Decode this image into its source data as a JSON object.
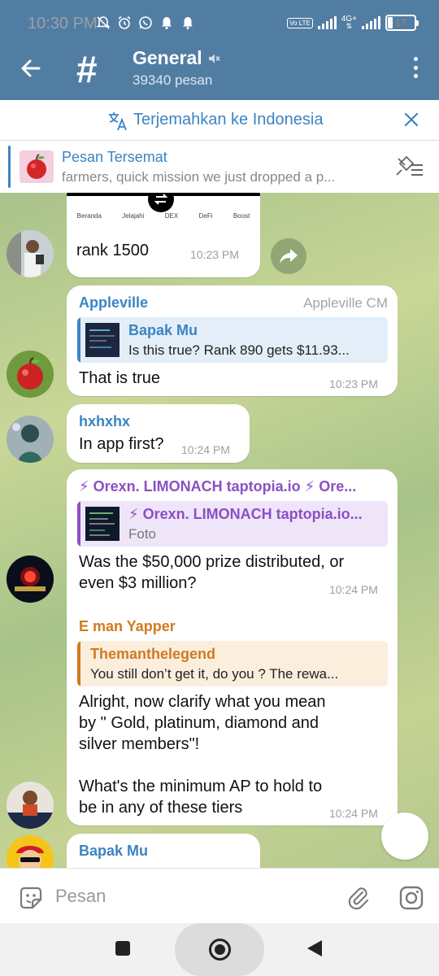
{
  "status_bar": {
    "time": "10:30 PM",
    "network": "4G+",
    "volte": "Vo LTE",
    "battery": "17"
  },
  "header": {
    "title": "General",
    "subtitle": "39340 pesan"
  },
  "translate_bar": {
    "label": "Terjemahkan ke Indonesia"
  },
  "pinned": {
    "title": "Pesan Tersemat",
    "text": "farmers, quick mission   we just dropped a p..."
  },
  "messages": [
    {
      "type": "screenshot-partial",
      "tabs": [
        "Beranda",
        "Jelajahi",
        "DEX",
        "DeFi",
        "Boost"
      ],
      "text": "rank 1500",
      "time": "10:23 PM"
    },
    {
      "sender": "Appleville",
      "sender_color": "#3b84c2",
      "role": "Appleville CM",
      "quote_name": "Bapak Mu",
      "quote_text": "Is this true? Rank 890 gets $11.93...",
      "text": "That is true",
      "time": "10:23 PM"
    },
    {
      "sender": "hxhxhx",
      "sender_color": "#3b84c2",
      "text": "In app first?",
      "time": "10:24 PM"
    },
    {
      "sender": "⚡ Orexn. LIMONACH taptopia.io ⚡ Ore...",
      "sender_color": "#8b4fc6",
      "quote_name": "⚡ Orexn. LIMONACH taptopia.io...",
      "quote_text": "Foto",
      "text_lines": [
        "Was the $50,000 prize distributed, or",
        "even $3 million?"
      ],
      "time": "10:24 PM"
    },
    {
      "sender": "E man Yapper",
      "sender_color": "#d07a20",
      "quote_name": "Themanthelegend",
      "quote_text": "You still don’t get it, do you ?   The rewa...",
      "text_lines": [
        "Alright, now clarify what you mean",
        "by \" Gold, platinum, diamond and",
        "silver members\"!",
        "",
        "What's the minimum AP to hold to",
        "be in any of these tiers"
      ],
      "time": "10:24 PM"
    },
    {
      "sender": "Bapak Mu",
      "sender_color": "#3b84c2"
    }
  ],
  "input": {
    "placeholder": "Pesan"
  },
  "colors": {
    "header": "#527da3",
    "accent": "#3b84c2"
  }
}
